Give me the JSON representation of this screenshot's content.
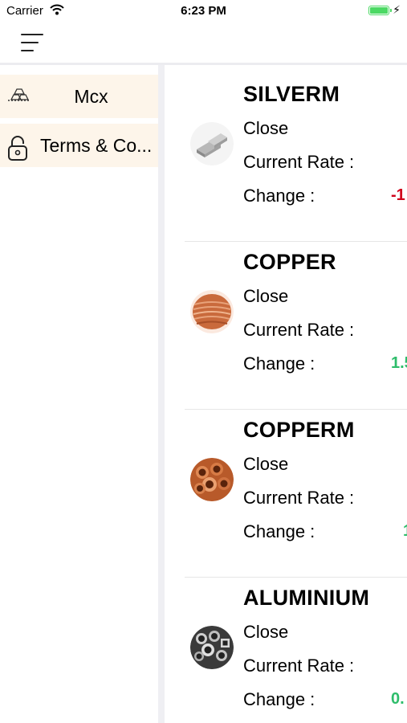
{
  "status_bar": {
    "carrier": "Carrier",
    "time": "6:23 PM"
  },
  "sidebar": {
    "items": [
      {
        "label": "Mcx",
        "icon": "gold-bars-icon"
      },
      {
        "label": "Terms & Co...",
        "icon": "lock-icon"
      }
    ]
  },
  "commodities": [
    {
      "name": "SILVERM",
      "close_label": "Close",
      "rate_label": "Current Rate :",
      "change_label": "Change :",
      "change_value": "-1",
      "trend": "down",
      "image": "silver-bars-image"
    },
    {
      "name": "COPPER",
      "close_label": "Close",
      "rate_label": "Current Rate :",
      "change_label": "Change :",
      "change_value": "1.5",
      "trend": "up",
      "image": "copper-wire-coil-image"
    },
    {
      "name": "COPPERM",
      "close_label": "Close",
      "rate_label": "Current Rate :",
      "change_label": "Change :",
      "change_value": "1",
      "trend": "up",
      "image": "copper-pipes-image"
    },
    {
      "name": "ALUMINIUM",
      "close_label": "Close",
      "rate_label": "Current Rate :",
      "change_label": "Change :",
      "change_value": "0.",
      "trend": "up",
      "image": "aluminium-pipes-image"
    }
  ],
  "colors": {
    "negative": "#d0021b",
    "positive": "#2ebd6b",
    "sidebar_item_bg": "#fdf5ea"
  }
}
